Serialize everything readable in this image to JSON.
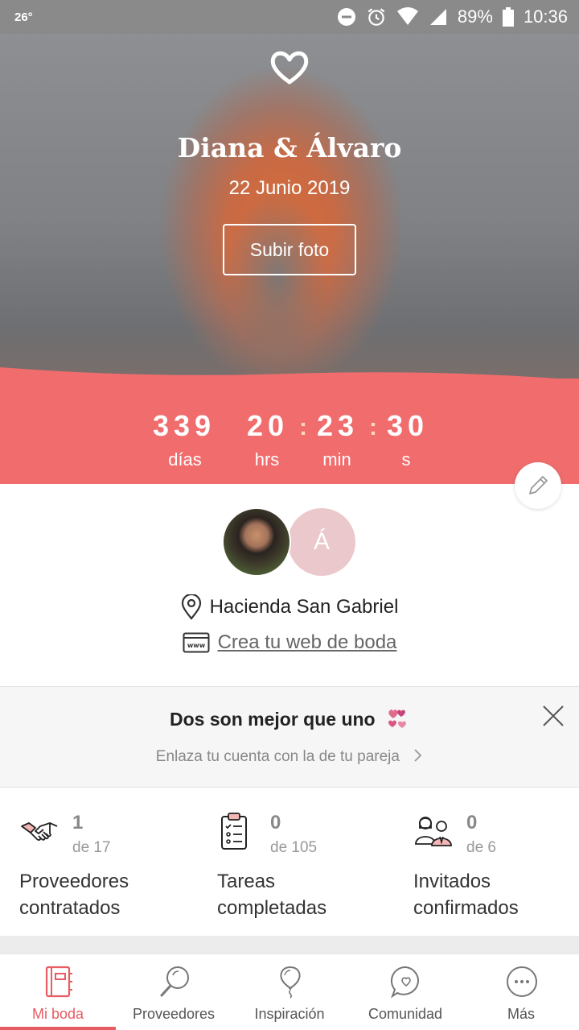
{
  "status_bar": {
    "temperature": "26°",
    "battery": "89%",
    "time": "10:36"
  },
  "hero": {
    "couple_names": "Diana & Álvaro",
    "wedding_date": "22 Junio 2019",
    "upload_label": "Subir foto"
  },
  "countdown": {
    "days": "339",
    "hours": "20",
    "minutes": "23",
    "seconds": "30",
    "days_label": "días",
    "hours_label": "hrs",
    "minutes_label": "min",
    "seconds_label": "s"
  },
  "profile": {
    "partner_initial": "Á",
    "venue": "Hacienda San Gabriel",
    "web_link": "Crea tu web de boda"
  },
  "banner": {
    "title": "Dos son mejor que uno",
    "subtitle": "Enlaza tu cuenta con la de tu pareja"
  },
  "stats": [
    {
      "count": "1",
      "total": "de 17",
      "label_line1": "Proveedores",
      "label_line2": "contratados",
      "icon": "handshake-icon"
    },
    {
      "count": "0",
      "total": "de 105",
      "label_line1": "Tareas",
      "label_line2": "completadas",
      "icon": "checklist-icon"
    },
    {
      "count": "0",
      "total": "de 6",
      "label_line1": "Invitados",
      "label_line2": "confirmados",
      "icon": "guests-icon"
    }
  ],
  "nav": [
    {
      "label": "Mi boda",
      "icon": "notebook-icon",
      "active": true
    },
    {
      "label": "Proveedores",
      "icon": "search-icon"
    },
    {
      "label": "Inspiración",
      "icon": "balloon-icon"
    },
    {
      "label": "Comunidad",
      "icon": "chat-heart-icon"
    },
    {
      "label": "Más",
      "icon": "more-icon"
    }
  ],
  "colors": {
    "accent": "#f06c6d",
    "nav_active": "#e95b62",
    "partner_avatar": "#ebc8cc"
  }
}
